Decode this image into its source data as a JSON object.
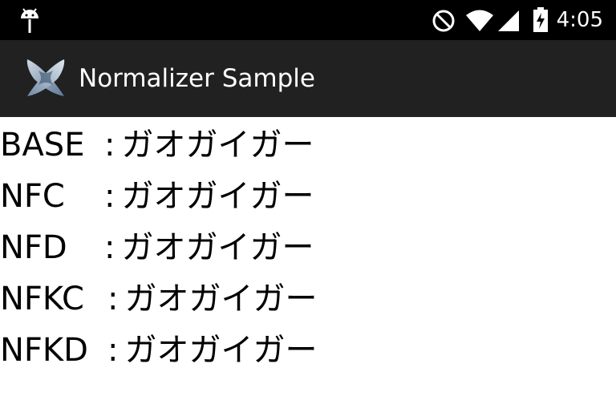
{
  "status_bar": {
    "time": "4:05",
    "icons": [
      "android-debug-icon",
      "do-not-disturb-icon",
      "wifi-icon",
      "cell-signal-icon",
      "battery-charging-icon"
    ]
  },
  "app_bar": {
    "title": "Normalizer Sample",
    "logo_icon": "xamarin-logo-icon"
  },
  "rows": [
    {
      "label": "BASE",
      "value": "ガオガイガー"
    },
    {
      "label": "NFC",
      "value": "ガオガイガー"
    },
    {
      "label": "NFD",
      "value": "ガオガイガー"
    },
    {
      "label": "NFKC",
      "value": "ガオガイガー"
    },
    {
      "label": "NFKD",
      "value": "ガオガイガー"
    }
  ],
  "separator": ":",
  "colors": {
    "status_bar": "#000000",
    "action_bar": "#212121",
    "content_bg": "#ffffff",
    "text": "#000000"
  }
}
